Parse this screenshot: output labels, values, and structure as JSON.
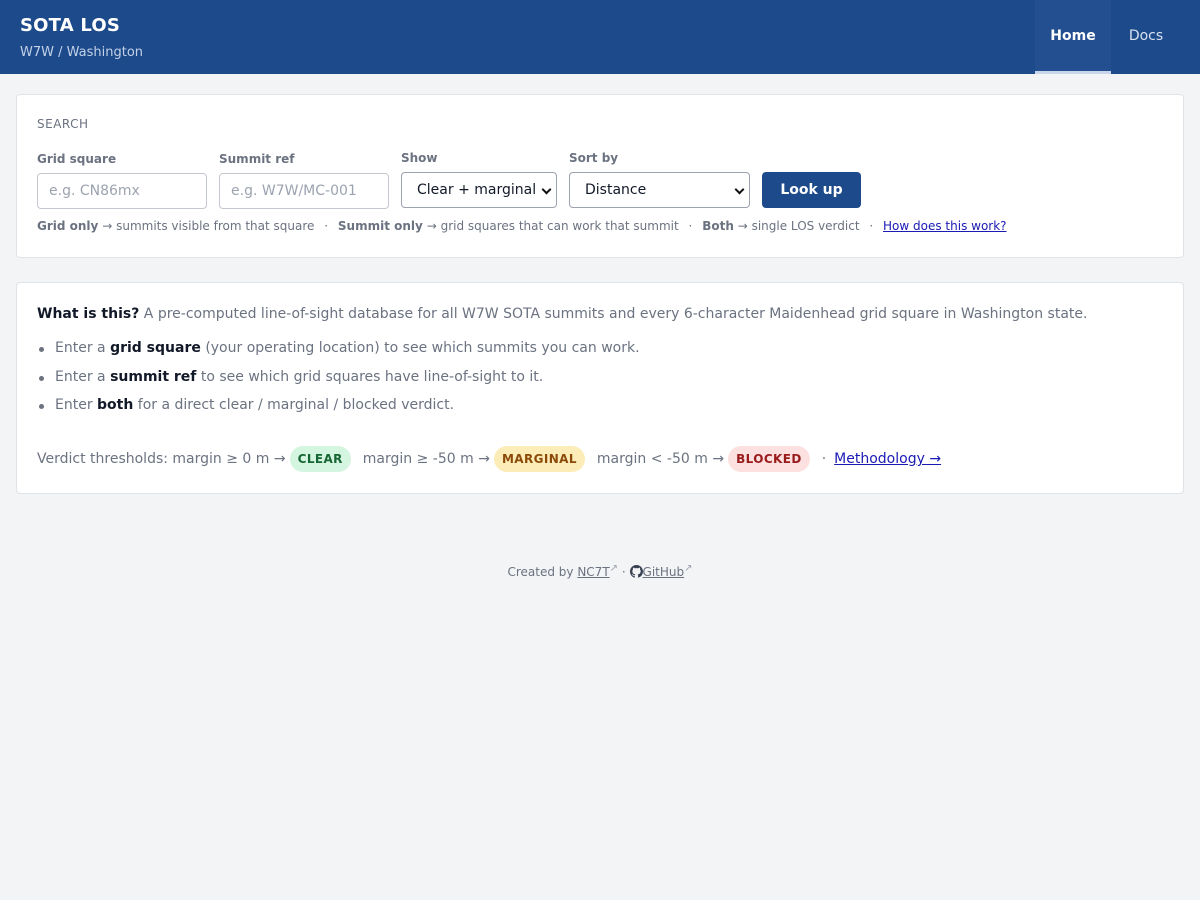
{
  "header": {
    "title": "SOTA LOS",
    "subtitle": "W7W / Washington",
    "nav": {
      "home": "Home",
      "docs": "Docs"
    }
  },
  "search": {
    "section_label": "SEARCH",
    "grid": {
      "label": "Grid square",
      "placeholder": "e.g. CN86mx"
    },
    "summit": {
      "label": "Summit ref",
      "placeholder": "e.g. W7W/MC-001"
    },
    "show": {
      "label": "Show",
      "value": "Clear + marginal"
    },
    "sort": {
      "label": "Sort by",
      "value": "Distance"
    },
    "button": "Look up",
    "hints": {
      "grid_only": "Grid only",
      "grid_only_desc": "summits visible from that square",
      "summit_only": "Summit only",
      "summit_only_desc": "grid squares that can work that summit",
      "both": "Both",
      "both_desc": "single LOS verdict",
      "how_link": "How does this work?"
    }
  },
  "info": {
    "what_label": "What is this?",
    "what_text": "A pre-computed line-of-sight database for all W7W SOTA summits and every 6-character Maidenhead grid square in Washington state.",
    "bullets": [
      {
        "pre": "Enter a",
        "bold": "grid square",
        "post": "(your operating location) to see which summits you can work."
      },
      {
        "pre": "Enter a",
        "bold": "summit ref",
        "post": "to see which grid squares have line-of-sight to it."
      },
      {
        "pre": "Enter",
        "bold": "both",
        "post": "for a direct clear / marginal / blocked verdict."
      }
    ],
    "thresholds": {
      "clear_text": "Verdict thresholds: margin ≥ 0 m →",
      "clear_badge": "CLEAR",
      "marginal_text": "margin ≥ -50 m →",
      "marginal_badge": "MARGINAL",
      "blocked_text": "margin < -50 m →",
      "blocked_badge": "BLOCKED",
      "methodology_link": "Methodology →"
    }
  },
  "footer": {
    "created_by": "Created by",
    "author": "NC7T",
    "sep": "·",
    "github": "GitHub"
  },
  "icons": {
    "external": "external-link-icon",
    "github": "github-icon"
  },
  "colors": {
    "brand": "#1c4a8a",
    "clear": "#166534",
    "marginal": "#8a4b08",
    "blocked": "#991b1b"
  }
}
